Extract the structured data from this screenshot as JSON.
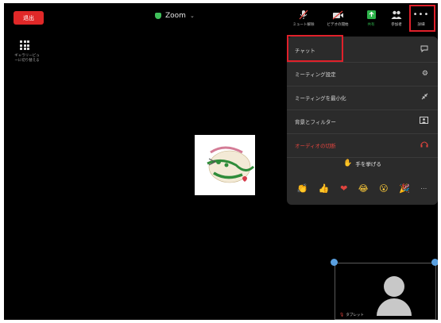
{
  "header": {
    "leave_label": "退出",
    "meeting_title": "Zoom",
    "toolbar": {
      "mute_label": "ミュート解除",
      "video_label": "ビデオの開始",
      "share_label": "共有",
      "participants_label": "参加者",
      "more_label": "詳細"
    }
  },
  "sidebar": {
    "gallery_label": "ギャラリービューに切り替える"
  },
  "more_menu": {
    "items": [
      {
        "label": "チャット",
        "icon": "chat-icon"
      },
      {
        "label": "ミーティング設定",
        "icon": "gear-icon"
      },
      {
        "label": "ミーティングを最小化",
        "icon": "minimize-icon"
      },
      {
        "label": "背景とフィルター",
        "icon": "background-icon"
      },
      {
        "label": "オーディオの切断",
        "icon": "headphones-icon"
      }
    ],
    "raise_hand_label": "手を挙げる",
    "reactions": [
      "👏",
      "👍",
      "❤",
      "😂",
      "😮",
      "🎉",
      "⋯"
    ]
  },
  "self_view": {
    "name": "タブレット"
  },
  "colors": {
    "accent_red": "#e0202a",
    "leave_red": "#e02828",
    "menu_bg": "#2b2b2b",
    "danger": "#e0443e"
  }
}
